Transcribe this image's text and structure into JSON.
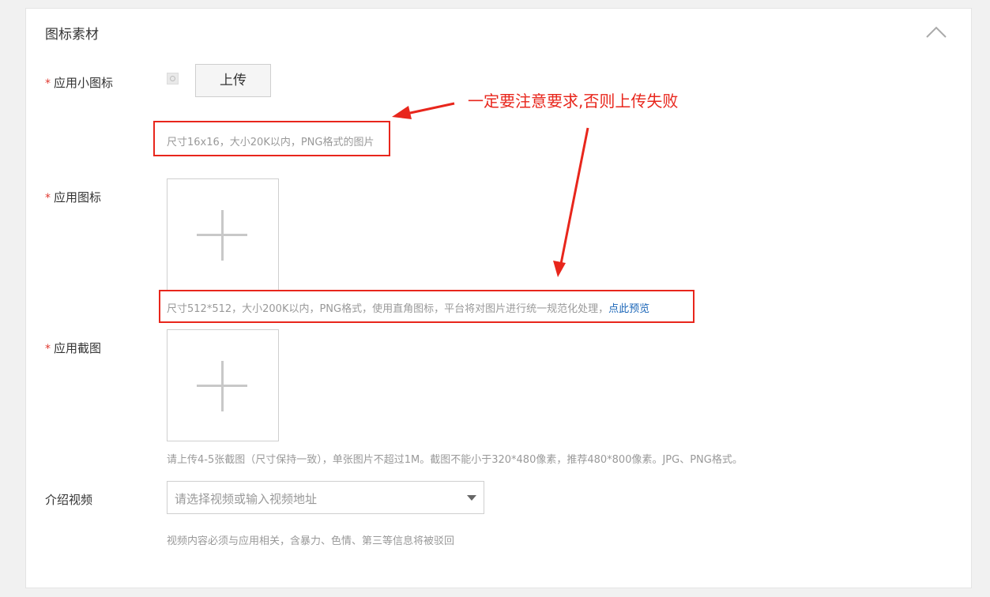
{
  "section": {
    "title": "图标素材"
  },
  "small_icon": {
    "label": "应用小图标",
    "upload_button": "上传",
    "hint": "尺寸16x16，大小20K以内，PNG格式的图片"
  },
  "app_icon": {
    "label": "应用图标",
    "hint": "尺寸512*512，大小200K以内，PNG格式，使用直角图标，平台将对图片进行统一规范化处理，",
    "preview_link": "点此预览"
  },
  "screenshots": {
    "label": "应用截图",
    "hint": "请上传4-5张截图（尺寸保持一致），单张图片不超过1M。截图不能小于320*480像素，推荐480*800像素。JPG、PNG格式。"
  },
  "video": {
    "label": "介绍视频",
    "placeholder": "请选择视频或输入视频地址",
    "hint": "视频内容必须与应用相关，含暴力、色情、第三等信息将被驳回"
  },
  "annotation": {
    "text": "一定要注意要求,否则上传失败",
    "color": "#e8261c"
  },
  "required_mark": "*"
}
